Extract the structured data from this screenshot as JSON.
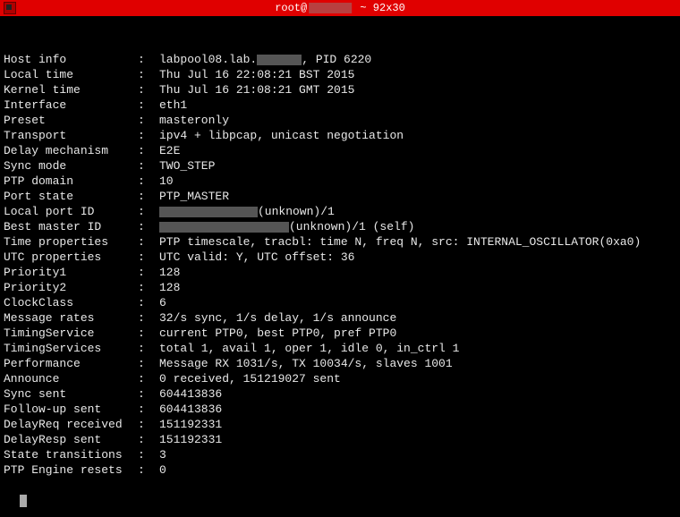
{
  "titlebar": {
    "prefix": "root@",
    "suffix": " ~ 92x30"
  },
  "rows": [
    {
      "label": "Host info",
      "value_pre": "labpool08.lab.",
      "redact": "w1",
      "value_post": ", PID 6220"
    },
    {
      "label": "Local time",
      "value": "Thu Jul 16 22:08:21 BST 2015"
    },
    {
      "label": "Kernel time",
      "value": "Thu Jul 16 21:08:21 GMT 2015"
    },
    {
      "label": "Interface",
      "value": "eth1"
    },
    {
      "label": "Preset",
      "value": "masteronly"
    },
    {
      "label": "Transport",
      "value": "ipv4 + libpcap, unicast negotiation"
    },
    {
      "label": "Delay mechanism",
      "value": "E2E"
    },
    {
      "label": "Sync mode",
      "value": "TWO_STEP"
    },
    {
      "label": "PTP domain",
      "value": "10"
    },
    {
      "label": "Port state",
      "value": "PTP_MASTER"
    },
    {
      "label": "Local port ID",
      "redact_first": "w2",
      "value_post": "(unknown)/1"
    },
    {
      "label": "Best master ID",
      "redact_first": "w3",
      "value_post": "(unknown)/1 (self)"
    },
    {
      "label": "Time properties",
      "value": "PTP timescale, tracbl: time N, freq N, src: INTERNAL_OSCILLATOR(0xa0)"
    },
    {
      "label": "UTC properties",
      "value": "UTC valid: Y, UTC offset: 36"
    },
    {
      "label": "Priority1",
      "value": "128"
    },
    {
      "label": "Priority2",
      "value": "128"
    },
    {
      "label": "ClockClass",
      "value": "6"
    },
    {
      "label": "Message rates",
      "value": "32/s sync, 1/s delay, 1/s announce"
    },
    {
      "label": "TimingService",
      "value": "current PTP0, best PTP0, pref PTP0"
    },
    {
      "label": "TimingServices",
      "value": "total 1, avail 1, oper 1, idle 0, in_ctrl 1"
    },
    {
      "label": "Performance",
      "value": "Message RX 1031/s, TX 10034/s, slaves 1001"
    },
    {
      "label": "Announce",
      "value": "0 received, 151219027 sent"
    },
    {
      "label": "Sync sent",
      "value": "604413836"
    },
    {
      "label": "Follow-up sent",
      "value": "604413836"
    },
    {
      "label": "DelayReq received",
      "value": "151192331"
    },
    {
      "label": "DelayResp sent",
      "value": "151192331"
    },
    {
      "label": "State transitions",
      "value": "3"
    },
    {
      "label": "PTP Engine resets",
      "value": "0"
    }
  ]
}
